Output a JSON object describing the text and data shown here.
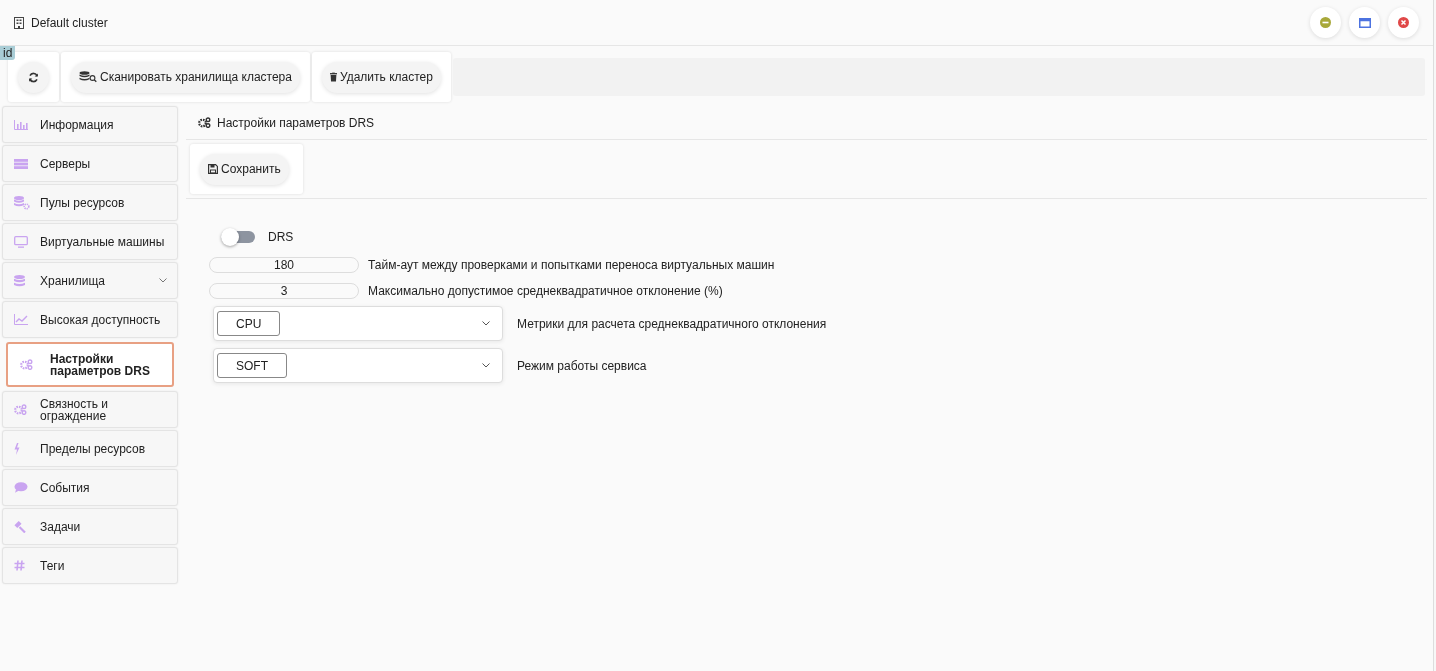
{
  "window": {
    "title": "Default cluster"
  },
  "id_badge": "id",
  "toolbar": [
    {
      "kind": "refresh"
    },
    {
      "kind": "scan",
      "label": "Сканировать хранилища кластера"
    },
    {
      "kind": "delete",
      "label": "Удалить кластер"
    }
  ],
  "sidebar": {
    "items": [
      {
        "kind": "chart",
        "label": "Информация",
        "selected": false,
        "has_submenu": false
      },
      {
        "kind": "server",
        "label": "Серверы",
        "selected": false,
        "has_submenu": false
      },
      {
        "kind": "pool",
        "label": "Пулы ресурсов",
        "selected": false,
        "has_submenu": false
      },
      {
        "kind": "monitor",
        "label": "Виртуальные машины",
        "selected": false,
        "has_submenu": false
      },
      {
        "kind": "database",
        "label": "Хранилища",
        "selected": false,
        "has_submenu": true
      },
      {
        "kind": "line",
        "label": "Высокая доступность",
        "selected": false,
        "has_submenu": false
      },
      {
        "kind": "gears",
        "label": "Настройки параметров DRS",
        "selected": true,
        "has_submenu": false
      },
      {
        "kind": "gears",
        "label": "Связность и ограждение",
        "selected": false,
        "has_submenu": false
      },
      {
        "kind": "bolt",
        "label": "Пределы ресурсов",
        "selected": false,
        "has_submenu": false
      },
      {
        "kind": "comment",
        "label": "События",
        "selected": false,
        "has_submenu": false
      },
      {
        "kind": "gavel",
        "label": "Задачи",
        "selected": false,
        "has_submenu": false
      },
      {
        "kind": "hash",
        "label": "Теги",
        "selected": false,
        "has_submenu": false
      }
    ]
  },
  "content": {
    "title": "Настройки параметров DRS",
    "save_button": "Сохранить",
    "drs_toggle": {
      "label": "DRS",
      "on": false
    },
    "number_fields": [
      {
        "value": "180",
        "label": "Тайм-аут между проверками и попытками переноса виртуальных машин"
      },
      {
        "value": "3",
        "label": "Максимально допустимое среднеквадратичное отклонение (%)"
      }
    ],
    "selects": [
      {
        "value": "CPU",
        "label": "Метрики для расчета среднеквадратичного отклонения"
      },
      {
        "value": "SOFT",
        "label": "Режим работы сервиса"
      }
    ]
  }
}
